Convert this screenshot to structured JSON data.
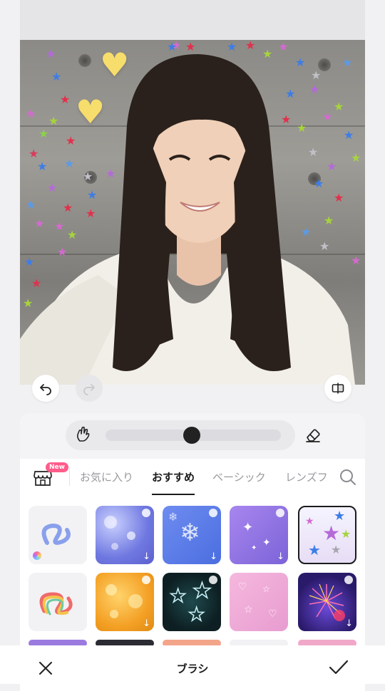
{
  "toolbar": {
    "undo_icon": "undo-icon",
    "redo_icon": "redo-icon",
    "compare_icon": "compare-icon"
  },
  "brush_panel": {
    "size_fraction": 0.49,
    "left_icon": "pinch-hand-icon",
    "right_icon": "eraser-icon"
  },
  "tabs": {
    "shop_badge": "New",
    "items": [
      {
        "label": "お気に入り",
        "active": false
      },
      {
        "label": "おすすめ",
        "active": true
      },
      {
        "label": "ベーシック",
        "active": false
      },
      {
        "label": "レンズフ",
        "active": false
      }
    ]
  },
  "bottom_bar": {
    "title": "ブラシ",
    "cancel_icon": "close-icon",
    "confirm_icon": "check-icon"
  },
  "colors": {
    "accent": "#1b1b1d",
    "badge": "#ff5c8a"
  }
}
